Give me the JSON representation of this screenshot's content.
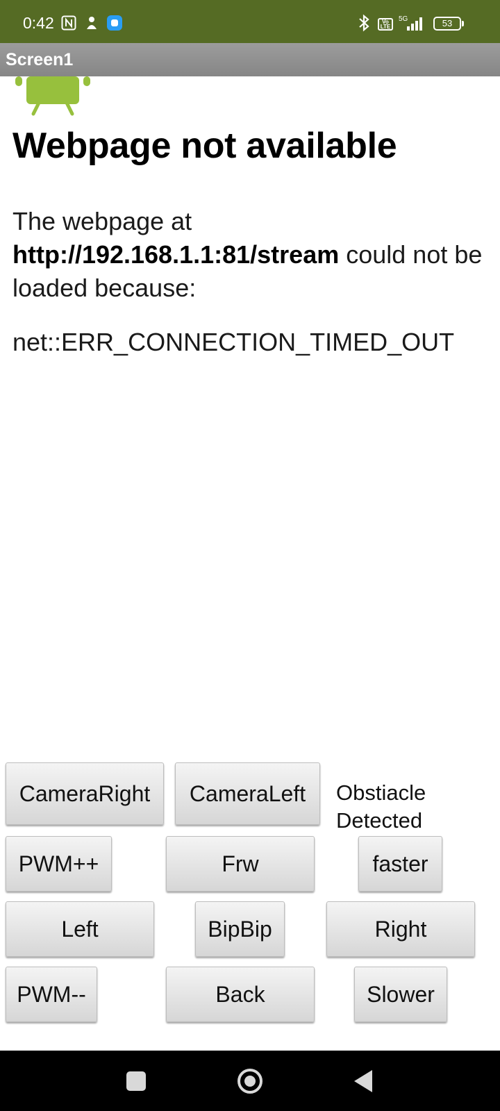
{
  "status_bar": {
    "time": "0:42",
    "volte": "Vo LTE",
    "network": "5G",
    "battery": "53",
    "icons": [
      "nfc-icon",
      "notification-icon",
      "app-icon",
      "bluetooth-icon",
      "volte-icon",
      "signal-icon",
      "battery-icon"
    ]
  },
  "title_bar": {
    "title": "Screen1"
  },
  "webview": {
    "error_title": "Webpage not available",
    "message_prefix": "The webpage at",
    "url": "http://192.168.1.1:81/stream",
    "message_suffix": " could not be loaded because:",
    "error_code": "net::ERR_CONNECTION_TIMED_OUT"
  },
  "controls": {
    "camera_right": "CameraRight",
    "camera_left": "CameraLeft",
    "obstacle_label": "Obstiacle Detected",
    "pwm_up": "PWM++",
    "forward": "Frw",
    "faster": "faster",
    "left": "Left",
    "bipbip": "BipBip",
    "right": "Right",
    "pwm_down": "PWM--",
    "back": "Back",
    "slower": "Slower"
  },
  "nav_bar": {
    "icons": [
      "recents-icon",
      "home-icon",
      "back-icon"
    ]
  }
}
